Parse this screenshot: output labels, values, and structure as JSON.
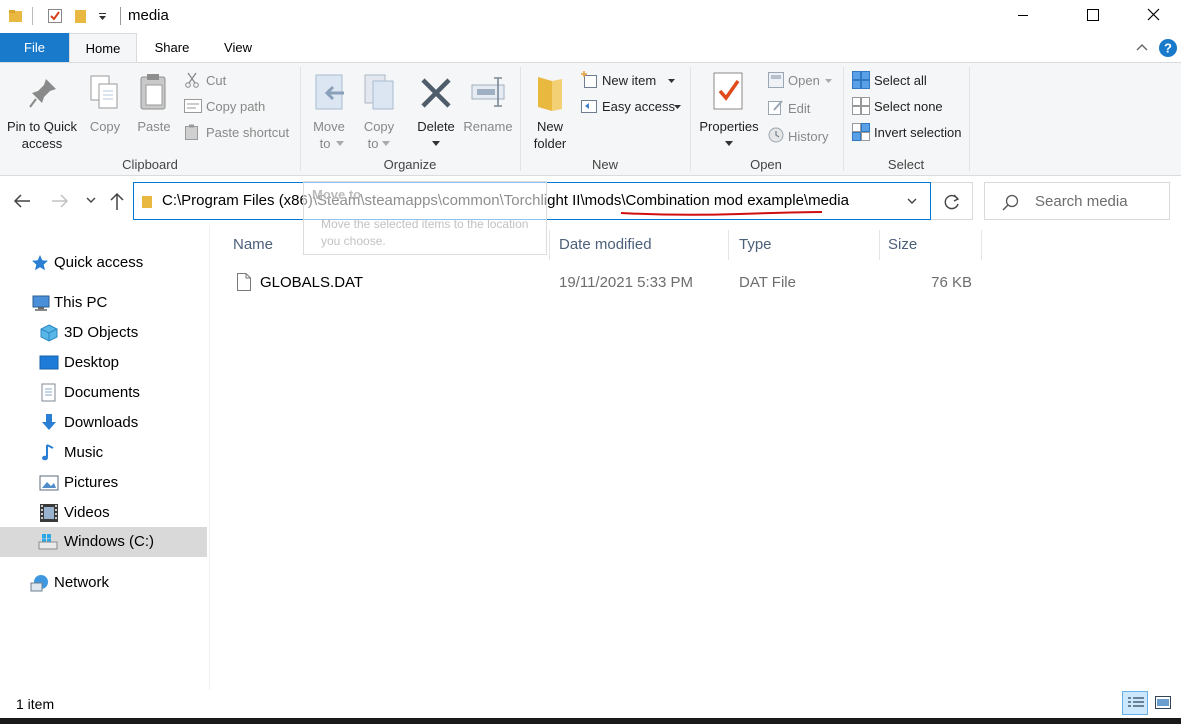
{
  "window": {
    "title": "media",
    "minimize_icon": "minimize-icon",
    "maximize_icon": "maximize-icon",
    "close_icon": "close-icon"
  },
  "tabs": [
    {
      "label": "File"
    },
    {
      "label": "Home"
    },
    {
      "label": "Share"
    },
    {
      "label": "View"
    }
  ],
  "ribbon": {
    "clipboard": {
      "pin_label": "Pin to Quick access",
      "pin_line1": "Pin to Quick",
      "pin_line2": "access",
      "copy": "Copy",
      "paste": "Paste",
      "cut": "Cut",
      "copy_path": "Copy path",
      "paste_shortcut": "Paste shortcut",
      "group": "Clipboard"
    },
    "organize": {
      "move_line1": "Move",
      "move_line2": "to",
      "copy_line1": "Copy",
      "copy_line2": "to",
      "delete": "Delete",
      "rename": "Rename",
      "group": "Organize"
    },
    "new": {
      "new_folder_line1": "New",
      "new_folder_line2": "folder",
      "new_item": "New item",
      "easy_access": "Easy access",
      "group": "New"
    },
    "open": {
      "properties": "Properties",
      "open": "Open",
      "edit": "Edit",
      "history": "History",
      "group": "Open"
    },
    "select": {
      "select_all": "Select all",
      "select_none": "Select none",
      "invert": "Invert selection",
      "group": "Select"
    }
  },
  "nav": {
    "address": "C:\\Program Files (x86)\\Steam\\steamapps\\common\\Torchlight II\\mods\\Combination mod example\\media",
    "search_placeholder": "Search media"
  },
  "tooltip": {
    "title": "Move to",
    "desc": "Move the selected items to the location you choose."
  },
  "sidebar": {
    "items": [
      {
        "label": "Quick access",
        "icon": "star-icon"
      },
      {
        "label": "This PC",
        "icon": "computer-icon"
      },
      {
        "label": "3D Objects",
        "icon": "cube-icon"
      },
      {
        "label": "Desktop",
        "icon": "desktop-icon"
      },
      {
        "label": "Documents",
        "icon": "document-icon"
      },
      {
        "label": "Downloads",
        "icon": "download-icon"
      },
      {
        "label": "Music",
        "icon": "music-icon"
      },
      {
        "label": "Pictures",
        "icon": "picture-icon"
      },
      {
        "label": "Videos",
        "icon": "video-icon"
      },
      {
        "label": "Windows (C:)",
        "icon": "drive-icon"
      },
      {
        "label": "Network",
        "icon": "network-icon"
      }
    ]
  },
  "files": {
    "columns": {
      "name": "Name",
      "date": "Date modified",
      "type": "Type",
      "size": "Size"
    },
    "rows": [
      {
        "name": "GLOBALS.DAT",
        "date": "19/11/2021 5:33 PM",
        "type": "DAT File",
        "size": "76 KB"
      }
    ]
  },
  "status": {
    "count": "1 item"
  },
  "colors": {
    "accent": "#1979ca",
    "address_border": "#0078d7",
    "annotation_underline": "#d01010"
  }
}
